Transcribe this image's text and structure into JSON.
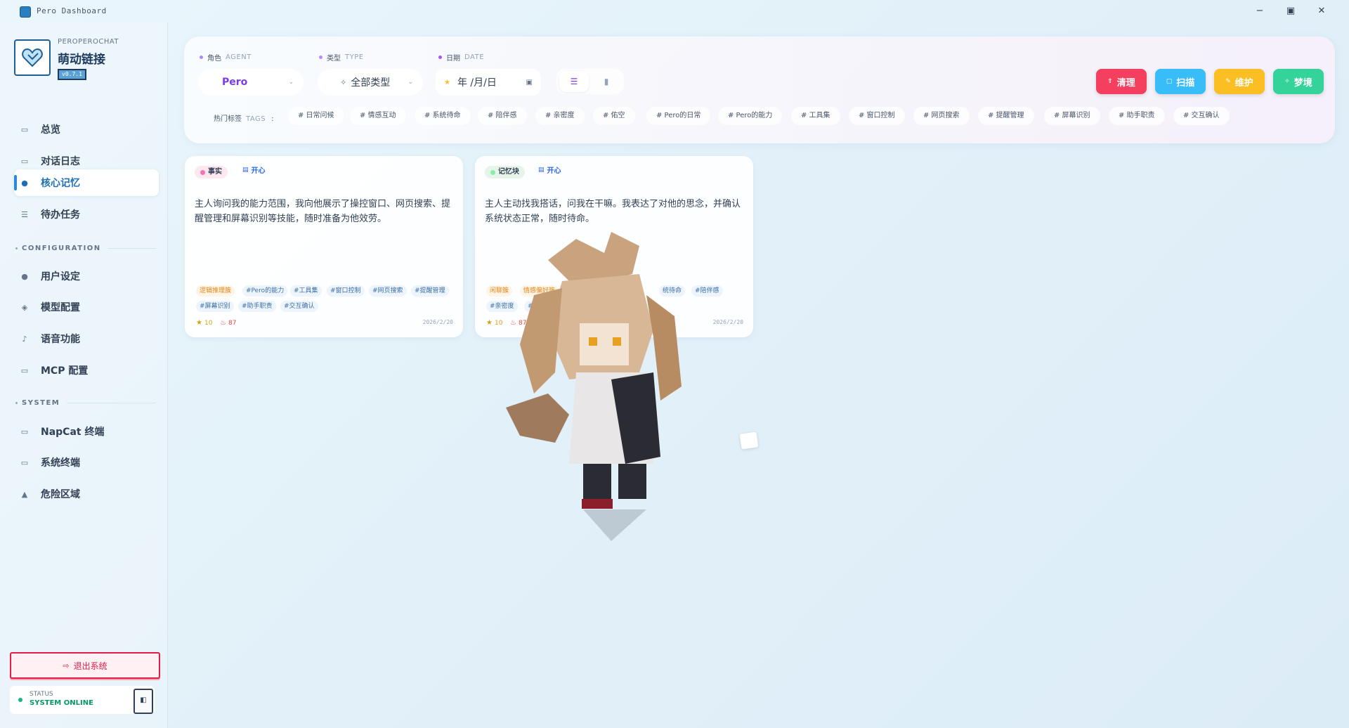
{
  "window": {
    "title": "Pero Dashboard",
    "controls": {
      "minimize": "−",
      "maximize": "▣",
      "close": "✕"
    }
  },
  "sidebar": {
    "brand_sub": "PEROPEROCHAT",
    "brand_title": "萌动链接",
    "version": "v0.7.1",
    "main_items": [
      {
        "label": "总览",
        "icon": "monitor-icon"
      },
      {
        "label": "对话日志",
        "icon": "chat-icon"
      },
      {
        "label": "核心记忆",
        "icon": "brain-icon",
        "active": true
      },
      {
        "label": "待办任务",
        "icon": "list-icon"
      }
    ],
    "config_section": "CONFIGURATION",
    "config_items": [
      {
        "label": "用户设定",
        "icon": "user-icon"
      },
      {
        "label": "模型配置",
        "icon": "cube-icon"
      },
      {
        "label": "语音功能",
        "icon": "mic-icon"
      },
      {
        "label": "MCP 配置",
        "icon": "plug-icon"
      }
    ],
    "system_section": "SYSTEM",
    "system_items": [
      {
        "label": "NapCat 终端",
        "icon": "terminal-icon"
      },
      {
        "label": "系统终端",
        "icon": "monitor-icon"
      },
      {
        "label": "危险区域",
        "icon": "warning-icon"
      }
    ],
    "logout": "退出系统",
    "status_label": "STATUS",
    "status_value": "SYSTEM ONLINE"
  },
  "filters": {
    "agent_label": "角色",
    "agent_label_en": "AGENT",
    "agent_value": "Pero",
    "type_label": "类型",
    "type_label_en": "TYPE",
    "type_value": "全部类型",
    "date_label": "日期",
    "date_label_en": "DATE",
    "date_value": "年 /月/日",
    "tags_label": "热门标签",
    "tags_label_en": "TAGS",
    "hot_tags": [
      "# 日常问候",
      "# 情感互动",
      "# 系统待命",
      "# 陪伴感",
      "# 亲密度",
      "# 佑空",
      "# Pero的日常",
      "# Pero的能力",
      "# 工具集",
      "# 窗口控制",
      "# 网页搜索",
      "# 提醒管理",
      "# 屏幕识别",
      "# 助手职责",
      "# 交互确认"
    ]
  },
  "actions": [
    {
      "label": "清理",
      "color": "#f43f5e"
    },
    {
      "label": "扫描",
      "color": "#38bdf8"
    },
    {
      "label": "维护",
      "color": "#fbbf24"
    },
    {
      "label": "梦境",
      "color": "#34d399"
    }
  ],
  "cards": [
    {
      "type_label": "事实",
      "mood": "开心",
      "content": "主人询问我的能力范围，我向他展示了操控窗口、网页搜索、提醒管理和屏幕识别等技能，随时准备为他效劳。",
      "tags": [
        {
          "text": "逻辑推理簇",
          "style": "orange"
        },
        {
          "text": "#Pero的能力",
          "style": "blue"
        },
        {
          "text": "#工具集",
          "style": "blue"
        },
        {
          "text": "#窗口控制",
          "style": "blue"
        },
        {
          "text": "#网页搜索",
          "style": "blue"
        },
        {
          "text": "#提醒管理",
          "style": "blue"
        },
        {
          "text": "#屏幕识别",
          "style": "blue"
        },
        {
          "text": "#助手职责",
          "style": "blue"
        },
        {
          "text": "#交互确认",
          "style": "blue"
        }
      ],
      "importance": "10",
      "heat": "87",
      "date": "2026/2/20"
    },
    {
      "type_label": "记忆块",
      "mood": "开心",
      "content": "主人主动找我搭话，问我在干嘛。我表达了对他的思念，并确认系统状态正常，随时待命。",
      "tags": [
        {
          "text": "闲聊簇",
          "style": "orange"
        },
        {
          "text": "情感偏好簇",
          "style": "orange"
        },
        {
          "text": "统待命",
          "style": "blue"
        },
        {
          "text": "#陪伴感",
          "style": "blue"
        },
        {
          "text": "#亲密度",
          "style": "blue"
        },
        {
          "text": "#佑空",
          "style": "blue"
        }
      ],
      "importance": "10",
      "heat": "87",
      "date": "2026/2/20"
    }
  ]
}
